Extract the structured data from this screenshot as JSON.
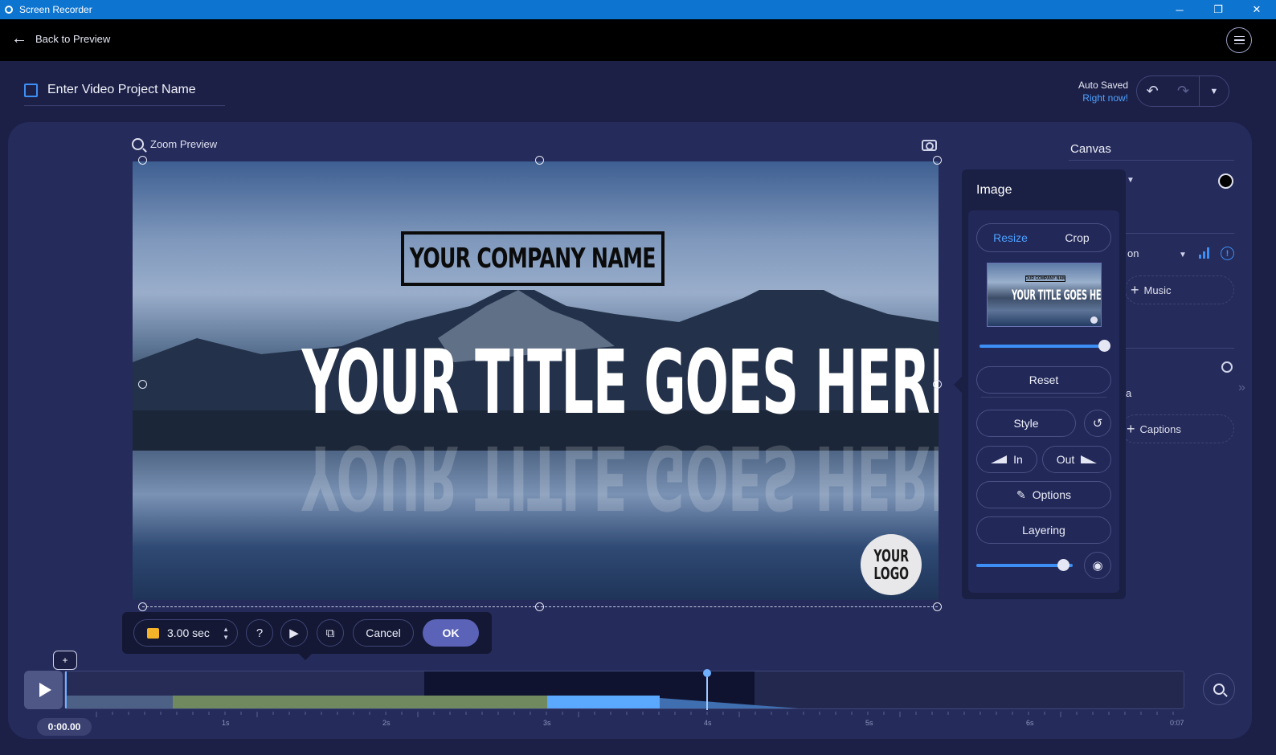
{
  "window": {
    "title": "Screen Recorder",
    "controls": {
      "minimize": "─",
      "restore": "❐",
      "close": "✕"
    }
  },
  "topbar": {
    "back_label": "Back to Preview"
  },
  "project": {
    "name": "Enter Video Project Name"
  },
  "save_status": {
    "line1": "Auto Saved",
    "line2": "Right now!"
  },
  "preview": {
    "zoom_label": "Zoom Preview",
    "company_name": "YOUR COMPANY NAME",
    "title": "YOUR TITLE GOES HERE",
    "logo_line1": "YOUR",
    "logo_line2": "LOGO"
  },
  "mini_toolbar": {
    "duration": "3.00 sec",
    "help": "?",
    "cancel_label": "Cancel",
    "ok_label": "OK"
  },
  "right_panel": {
    "canvas_label": "Canvas",
    "partial_text_1": "on",
    "music_label": "Music",
    "partial_text_2": "a",
    "captions_label": "Captions"
  },
  "image_popup": {
    "title": "Image",
    "tabs": [
      {
        "label": "Resize",
        "active": true
      },
      {
        "label": "Crop",
        "active": false
      }
    ],
    "thumb_company": "YOUR COMPANY NAME",
    "thumb_title": "YOUR TITLE GOES HERE",
    "size_level": 1.0,
    "reset_label": "Reset",
    "style_label": "Style",
    "in_label": "In",
    "out_label": "Out",
    "options_label": "Options",
    "layering_label": "Layering",
    "opacity_level": 0.9
  },
  "timeline": {
    "add_marker": "+",
    "current_time": "0:00.00",
    "ticks": [
      "1s",
      "2s",
      "3s",
      "4s",
      "5s",
      "6s",
      "0:07"
    ]
  },
  "colors": {
    "accent": "#3d8ef5",
    "titlebar": "#0d74d0",
    "background": "#1c2047",
    "panel": "#252b5a",
    "ok_button": "#5a63b8"
  }
}
